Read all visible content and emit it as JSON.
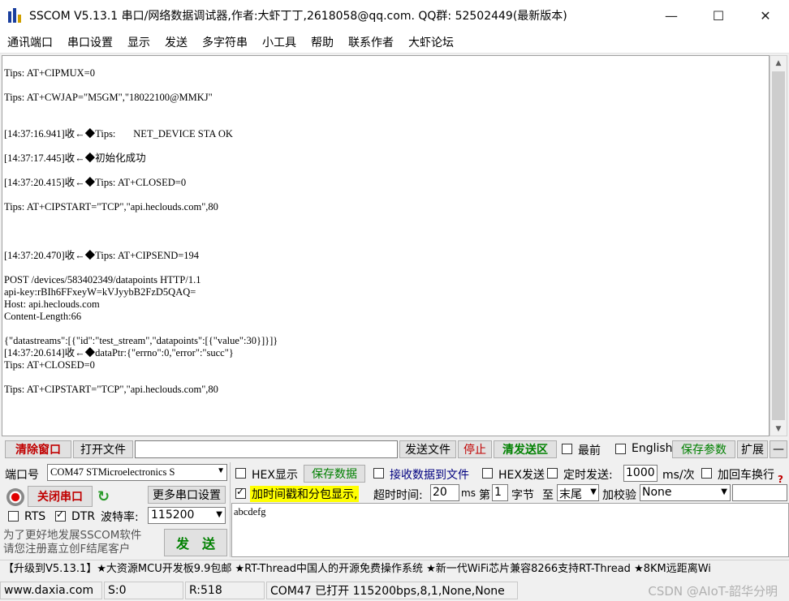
{
  "window": {
    "title": "SSCOM V5.13.1 串口/网络数据调试器,作者:大虾丁丁,2618058@qq.com. QQ群: 52502449(最新版本)",
    "minimize": "—",
    "maximize": "☐",
    "close": "✕"
  },
  "menu": [
    "通讯端口",
    "串口设置",
    "显示",
    "发送",
    "多字符串",
    "小工具",
    "帮助",
    "联系作者",
    "大虾论坛"
  ],
  "output_lines": [
    "Tips: AT+CIPMUX=0",
    "",
    "Tips: AT+CWJAP=\"M5GM\",\"18022100@MMKJ\"",
    "",
    "",
    "[14:37:16.941]收←◆Tips:       NET_DEVICE STA OK",
    "",
    "[14:37:17.445]收←◆初始化成功",
    "",
    "[14:37:20.415]收←◆Tips: AT+CLOSED=0",
    "",
    "Tips: AT+CIPSTART=\"TCP\",\"api.heclouds.com\",80",
    "",
    "",
    "",
    "[14:37:20.470]收←◆Tips: AT+CIPSEND=194",
    "",
    "POST /devices/583402349/datapoints HTTP/1.1",
    "api-key:rBIh6FFxeyW=kVJyybB2FzD5QAQ=",
    "Host: api.heclouds.com",
    "Content-Length:66",
    "",
    "{\"datastreams\":[{\"id\":\"test_stream\",\"datapoints\":[{\"value\":30}]}]}",
    "[14:37:20.614]收←◆dataPtr:{\"errno\":0,\"error\":\"succ\"}",
    "Tips: AT+CLOSED=0",
    "",
    "Tips: AT+CIPSTART=\"TCP\",\"api.heclouds.com\",80"
  ],
  "toolbar": {
    "clear_window": "清除窗口",
    "open_file": "打开文件",
    "send_file": "发送文件",
    "stop": "停止",
    "clear_send": "清发送区",
    "topmost": "最前",
    "english": "English",
    "save_params": "保存参数",
    "expand": "扩展",
    "collapse": "—"
  },
  "port": {
    "port_label": "端口号",
    "port_value": "COM47 STMicroelectronics S",
    "close_port": "关闭串口",
    "more_settings": "更多串口设置",
    "rts": "RTS",
    "dtr": "DTR",
    "baud_label": "波特率:",
    "baud_value": "115200",
    "promo_line1": "为了更好地发展SSCOM软件",
    "promo_line2": "请您注册嘉立创F结尾客户",
    "send_button": "发　送"
  },
  "options": {
    "hex_display": "HEX显示",
    "save_data": "保存数据",
    "recv_to_file": "接收数据到文件",
    "hex_send": "HEX发送",
    "timed_send": "定时发送:",
    "interval_value": "1000",
    "interval_unit": "ms/次",
    "add_crlf": "加回车换行",
    "timestamp": "加时间戳和分包显示,",
    "timeout_label": "超时时间:",
    "timeout_value": "20",
    "timeout_unit": "ms",
    "packet_label": "第",
    "packet_value": "1",
    "byte_label": "字节",
    "to_label": "至",
    "to_value": "末尾",
    "checksum_label": "加校验",
    "checksum_value": "None"
  },
  "send_text": "abcdefg",
  "ticker": "【升级到V5.13.1】★大资源MCU开发板9.9包邮 ★RT-Thread中国人的开源免费操作系统 ★新一代WiFi芯片兼容8266支持RT-Thread ★8KM远距离Wi",
  "status": {
    "website": "www.daxia.com",
    "sent": "S:0",
    "received": "R:518",
    "port_status": "COM47 已打开  115200bps,8,1,None,None"
  },
  "watermark": "CSDN @AIoT-韶华分明"
}
